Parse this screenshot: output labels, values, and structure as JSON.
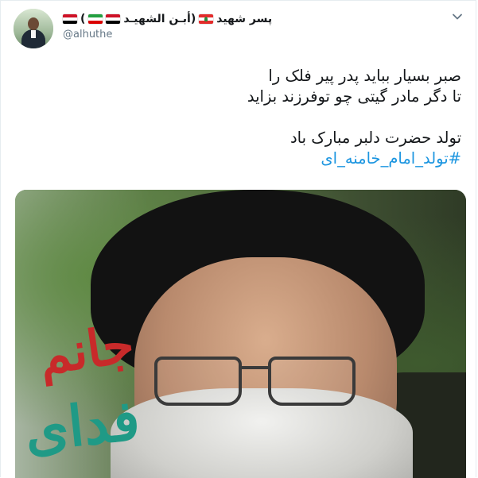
{
  "author": {
    "name_part1": "پسر شهید",
    "name_part2": "(أبـن الشهيـد",
    "name_paren_close": ")",
    "handle": "@alhuthe"
  },
  "icons": {
    "menu": "chevron-down-icon",
    "flags": [
      "lebanon-flag-icon",
      "yemen-flag-icon",
      "iran-flag-icon",
      "iraq-flag-icon"
    ]
  },
  "tweet": {
    "line1": "صبر بسیار بباید پدر پیر فلک را",
    "line2": "تا دگر مادر گیتی چو توفرزند بزاید",
    "line3": "تولد حضرت دلبر مبارک باد",
    "hashtag": "#تولد_امام_خامنه_ای"
  },
  "media": {
    "calligraphy_red": "جانم",
    "calligraphy_teal": "فدای"
  },
  "colors": {
    "hashtag": "#1b95e0",
    "handle": "#657786",
    "border": "#e6ecf0"
  }
}
